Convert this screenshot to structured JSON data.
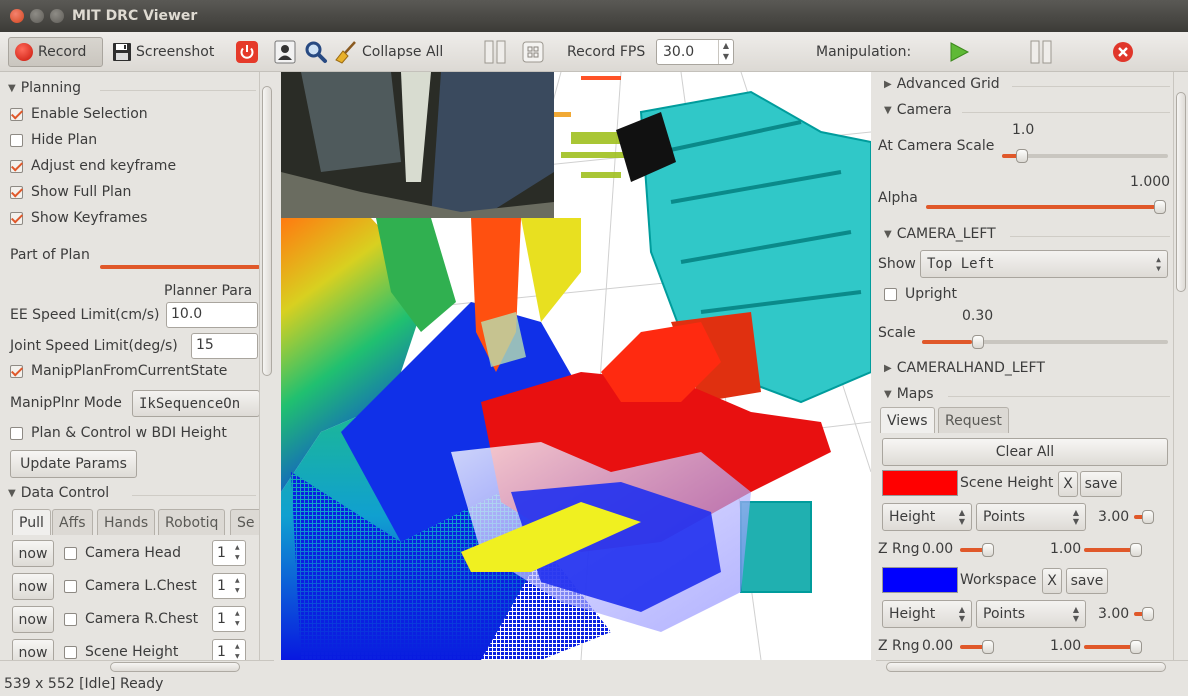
{
  "window": {
    "title": "MIT DRC Viewer"
  },
  "toolbar": {
    "record_label": "Record",
    "screenshot_label": "Screenshot",
    "collapse_all_label": "Collapse All",
    "record_fps_label": "Record FPS",
    "record_fps_value": "30.0",
    "manipulation_label": "Manipulation:"
  },
  "left": {
    "planning": {
      "header": "Planning",
      "checks": [
        {
          "label": "Enable Selection",
          "checked": true
        },
        {
          "label": "Hide Plan",
          "checked": false
        },
        {
          "label": "Adjust end keyframe",
          "checked": true
        },
        {
          "label": "Show Full Plan",
          "checked": true
        },
        {
          "label": "Show Keyframes",
          "checked": true
        }
      ],
      "part_of_plan_label": "Part of Plan",
      "planner_params_label": "Planner Para",
      "ee_speed_label": "EE Speed Limit(cm/s)",
      "ee_speed_value": "10.0",
      "joint_speed_label": "Joint Speed Limit(deg/s)",
      "joint_speed_value": "15",
      "manip_from_current_label": "ManipPlanFromCurrentState",
      "manip_from_current_checked": true,
      "manip_mode_label": "ManipPlnr Mode",
      "manip_mode_value": "IkSequenceOn",
      "plan_control_label": "Plan & Control w BDI Height",
      "plan_control_checked": false,
      "update_params_label": "Update Params"
    },
    "data_control": {
      "header": "Data Control",
      "tabs": [
        "Pull",
        "Affs",
        "Hands",
        "Robotiq",
        "Se"
      ],
      "rows": [
        {
          "button": "now",
          "label": "Camera Head",
          "value": "1"
        },
        {
          "button": "now",
          "label": "Camera L.Chest",
          "value": "1"
        },
        {
          "button": "now",
          "label": "Camera R.Chest",
          "value": "1"
        },
        {
          "button": "now",
          "label": "Scene Height",
          "value": "1"
        }
      ]
    }
  },
  "right": {
    "advanced_grid_label": "Advanced Grid",
    "camera_header": "Camera",
    "at_camera_scale_label": "At Camera Scale",
    "at_camera_scale_value": "1.0",
    "alpha_label": "Alpha",
    "alpha_value": "1.000",
    "camera_left_header": "CAMERA_LEFT",
    "show_label": "Show",
    "show_value": "Top Left",
    "upright_label": "Upright",
    "scale_label": "Scale",
    "scale_value": "0.30",
    "cameralhand_header": "CAMERALHAND_LEFT",
    "maps_header": "Maps",
    "maps_tabs": [
      "Views",
      "Request"
    ],
    "clear_all_label": "Clear All",
    "maps": [
      {
        "name": "Scene Height",
        "color": "#ff0000",
        "x_label": "X",
        "save_label": "save",
        "mode": "Height",
        "render": "Points",
        "size": "3.00",
        "zrng_label": "Z Rng",
        "zmin": "0.00",
        "zmax": "1.00"
      },
      {
        "name": "Workspace",
        "color": "#0000ff",
        "x_label": "X",
        "save_label": "save",
        "mode": "Height",
        "render": "Points",
        "size": "3.00",
        "zrng_label": "Z Rng",
        "zmin": "0.00",
        "zmax": "1.00"
      }
    ]
  },
  "status": {
    "text": "539 x 552 [Idle] Ready"
  },
  "colors": {
    "accent": "#e0582a",
    "record_red": "#d11f10",
    "play_green": "#5fb936",
    "close_red": "#e0362a"
  }
}
